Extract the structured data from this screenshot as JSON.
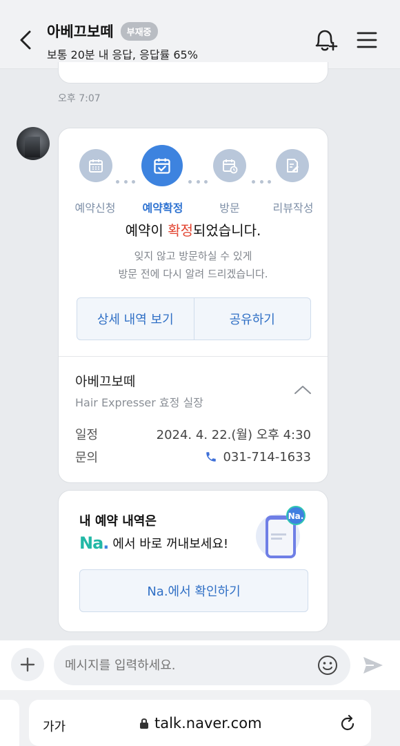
{
  "header": {
    "title": "아베끄보떼",
    "badge": "부재중",
    "subtitle": "보통 20분 내 응답, 응답률 65%"
  },
  "chat": {
    "time": "오후 7:07"
  },
  "reservation": {
    "steps": [
      {
        "label": "예약신청",
        "icon": "calendar-icon"
      },
      {
        "label": "예약확정",
        "icon": "calendar-check-icon"
      },
      {
        "label": "방문",
        "icon": "calendar-clock-icon"
      },
      {
        "label": "리뷰작성",
        "icon": "edit-note-icon"
      }
    ],
    "title_pre": "예약이 ",
    "title_hl": "확정",
    "title_post": "되었습니다.",
    "desc_line1": "잊지 않고 방문하실 수 있게",
    "desc_line2": "방문 전에 다시 알려 드리겠습니다.",
    "btn_detail": "상세 내역 보기",
    "btn_share": "공유하기",
    "shop_name": "아베끄보떼",
    "shop_sub": "Hair Expresser 효정 실장",
    "schedule_label": "일정",
    "schedule_value": "2024. 4. 22.(월) 오후 4:30",
    "contact_label": "문의",
    "contact_value": "031-714-1633",
    "highlight_color": "#e2432f",
    "accent_color": "#3d83df"
  },
  "promo": {
    "line1": "내 예약 내역은",
    "na_text": "Na",
    "na_dot": ".",
    "line2": "에서 바로 꺼내보세요!",
    "art_badge": "Na.",
    "button": "Na.에서 확인하기"
  },
  "input": {
    "placeholder": "메시지를 입력하세요."
  },
  "browser": {
    "text_size": "가가",
    "url": "talk.naver.com"
  }
}
